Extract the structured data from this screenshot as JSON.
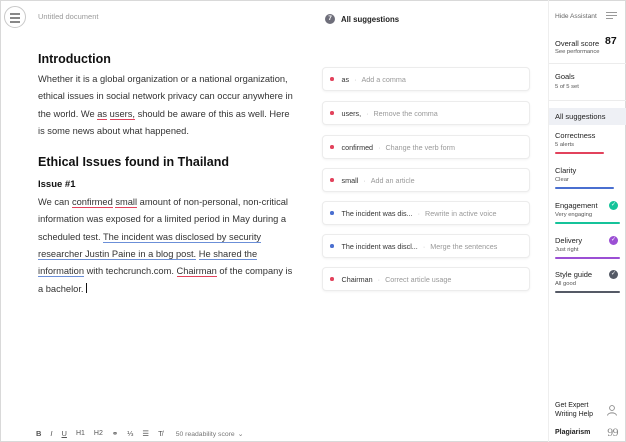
{
  "document": {
    "title": "Untitled document",
    "heading1": "Introduction",
    "intro": {
      "part1": "Whether it is a global organization or a national organization, ethical issues in social network privacy can occur anywhere in the world. We ",
      "as": "as",
      "space1": " ",
      "users": "users,",
      "part2": " should be aware of this as well. Here is some news about what happened."
    },
    "heading2": "Ethical Issues found in Thailand",
    "heading3": "Issue #1",
    "issue": {
      "part1": "We can ",
      "confirmed": "confirmed",
      "space1": " ",
      "small": "small",
      "part2": " amount of non-personal, non-critical information was exposed for a limited period in May during a scheduled test. ",
      "disclosed": "The incident was disclosed by security researcher Justin Paine in a blog post.",
      "space2": " ",
      "shared": "He shared the information",
      "part3": " with techcrunch.com. ",
      "chairman": "Chairman",
      "part4": " of the company is a bachelor."
    }
  },
  "toolbar": {
    "bold": "B",
    "italic": "I",
    "underline": "U",
    "h1": "H1",
    "h2": "H2",
    "link_glyph": "⚭",
    "ol_glyph": "⅓",
    "ul_glyph": "☰",
    "clear_glyph": "T̸",
    "readability": "50 readability score",
    "readability_caret": "⌄"
  },
  "suggestions": {
    "count": "7",
    "title": "All suggestions",
    "items": [
      {
        "word": "as",
        "action": "Add a comma",
        "color": "red"
      },
      {
        "word": "users,",
        "action": "Remove the comma",
        "color": "red"
      },
      {
        "word": "confirmed",
        "action": "Change the verb form",
        "color": "red"
      },
      {
        "word": "small",
        "action": "Add an article",
        "color": "red"
      },
      {
        "word": "The incident was dis...",
        "action": "Rewrite in active voice",
        "color": "blue"
      },
      {
        "word": "The incident was discl...",
        "action": "Merge the sentences",
        "color": "blue"
      },
      {
        "word": "Chairman",
        "action": "Correct article usage",
        "color": "red"
      }
    ],
    "separator": "·"
  },
  "assistant": {
    "hide_label": "Hide Assistant",
    "overall_label": "Overall score",
    "overall_value": "87",
    "see_performance": "See performance",
    "goals_label": "Goals",
    "goals_sub": "5 of 5 set",
    "all_suggestions_tab": "All suggestions",
    "categories": [
      {
        "name": "Correctness",
        "sub": "5 alerts",
        "bar_color": "#e2425c",
        "bar_fill": 0.75
      },
      {
        "name": "Clarity",
        "sub": "Clear",
        "bar_color": "#4a6fd0",
        "bar_fill": 0.9
      },
      {
        "name": "Engagement",
        "sub": "Very engaging",
        "bar_color": "#15c39a",
        "bar_fill": 1.0,
        "check": "✓",
        "icon_color": "#15c39a"
      },
      {
        "name": "Delivery",
        "sub": "Just right",
        "bar_color": "#9b4fd4",
        "bar_fill": 1.0,
        "check": "✓",
        "icon_color": "#9b4fd4"
      },
      {
        "name": "Style guide",
        "sub": "All good",
        "bar_color": "#555a66",
        "bar_fill": 1.0,
        "check": "✓",
        "icon_color": "#555a66"
      }
    ],
    "expert_line1": "Get Expert",
    "expert_line2": "Writing Help",
    "plagiarism": "Plagiarism",
    "plagiarism_glyph": "99"
  },
  "colors": {
    "red": "#e2425c",
    "blue": "#4a6fd0"
  }
}
